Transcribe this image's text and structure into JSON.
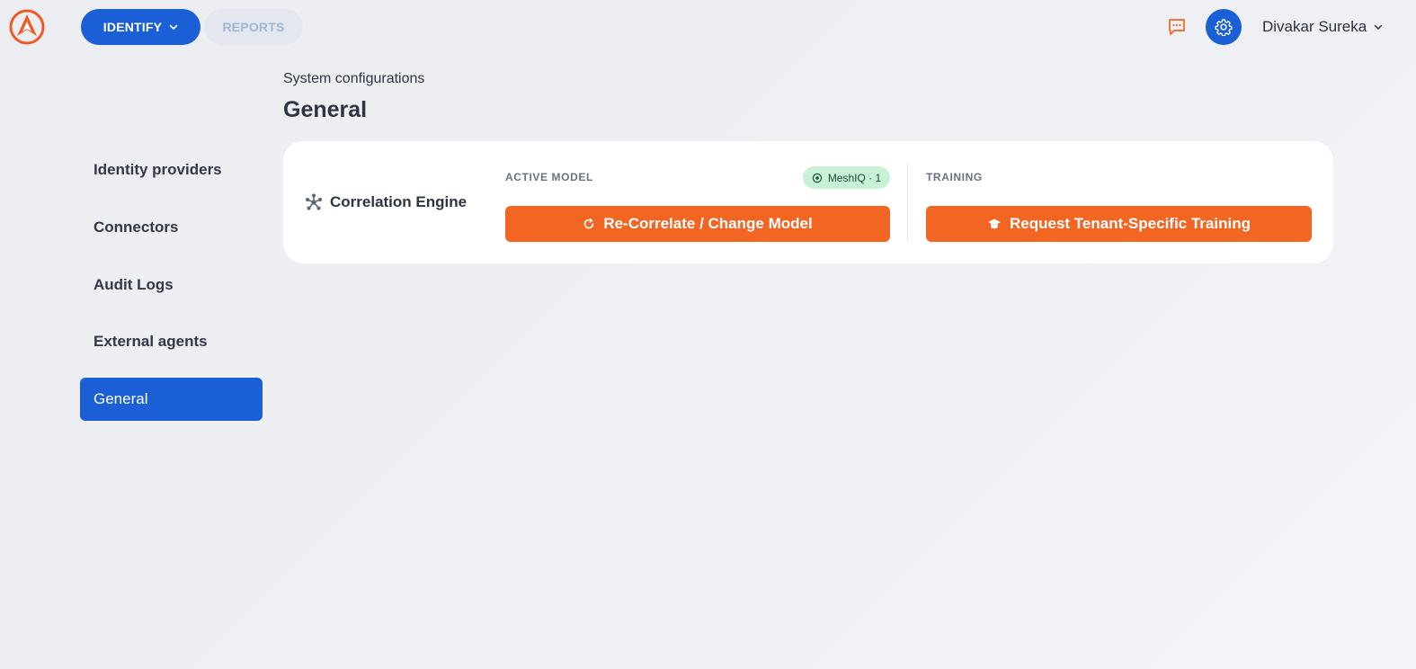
{
  "nav": {
    "identify_label": "IDENTIFY",
    "reports_label": "REPORTS"
  },
  "header": {
    "user_name": "Divakar Sureka"
  },
  "sidebar": {
    "items": [
      {
        "label": "Identity providers"
      },
      {
        "label": "Connectors"
      },
      {
        "label": "Audit Logs"
      },
      {
        "label": "External agents"
      },
      {
        "label": "General"
      }
    ],
    "active": "General"
  },
  "main": {
    "breadcrumb": "System configurations",
    "title": "General",
    "card": {
      "engine_label": "Correlation Engine",
      "active_model_label": "ACTIVE MODEL",
      "model_badge": "MeshIQ · 1",
      "training_label": "TRAINING",
      "recorrelate_button": "Re-Correlate / Change Model",
      "training_button": "Request Tenant-Specific Training"
    }
  },
  "colors": {
    "brand_blue": "#1a5fd6",
    "accent_orange": "#f36522",
    "badge_green": "#c7f2d8"
  },
  "icons": {
    "logo": "brand-logo-icon",
    "chat": "chat-icon",
    "settings": "gear-icon",
    "engine": "network-nodes-icon",
    "refresh": "refresh-icon",
    "training": "graduation-cap-icon",
    "model": "chip-icon"
  }
}
